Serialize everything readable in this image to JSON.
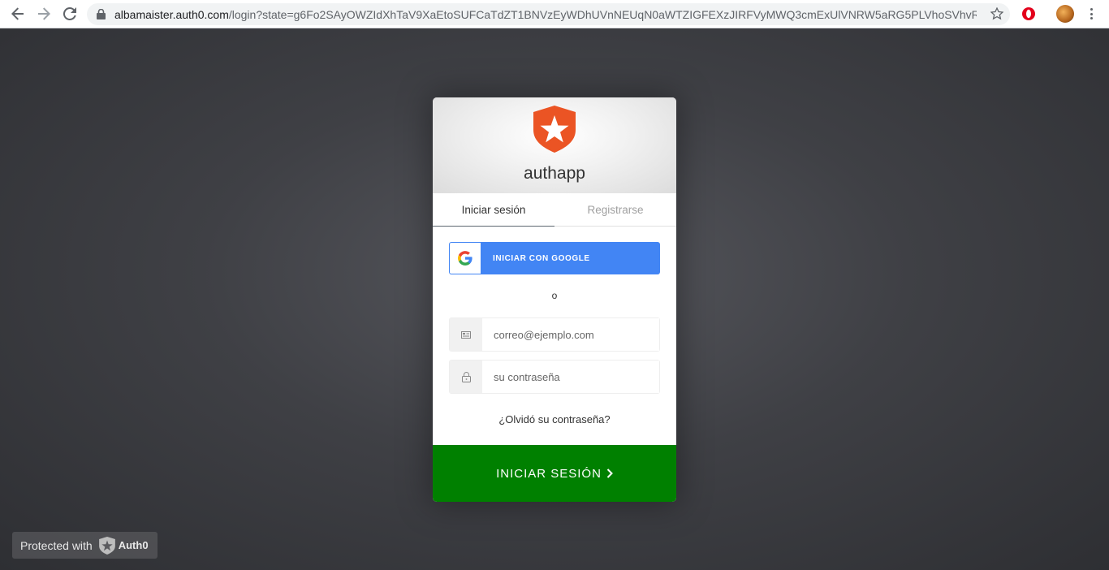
{
  "browser": {
    "url_host": "albamaister.auth0.com",
    "url_path": "/login?state=g6Fo2SAyOWZIdXhTaV9XaEtoSUFCaTdZT1BNVzEyWDhUVnNEUqN0aWTZIGFEXzJIRFVyMWQ3cmExUlVNRW5aRG5PLVhoSVhvRkxPo2N..."
  },
  "widget": {
    "app_name": "authapp",
    "tabs": [
      "Iniciar sesión",
      "Registrarse"
    ],
    "active_tab": "Iniciar sesión",
    "google_button": "INICIAR CON GOOGLE",
    "or_text": "o",
    "email_placeholder": "correo@ejemplo.com",
    "password_placeholder": "su contraseña",
    "forgot_password": "¿Olvidó su contraseña?",
    "submit": "INICIAR SESIÓN"
  },
  "badge": {
    "text": "Protected with",
    "brand": "Auth0"
  },
  "colors": {
    "brand": "#eb5424",
    "google": "#4285f4",
    "submit": "#008000"
  }
}
